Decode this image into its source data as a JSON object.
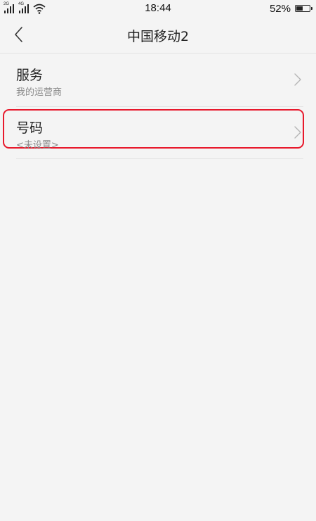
{
  "status_bar": {
    "sim1_tag": "2G",
    "sim2_tag": "4G",
    "time": "18:44",
    "battery_percent": "52%",
    "battery_level": 0.52,
    "icons": [
      "signal-icon",
      "signal-icon",
      "wifi-icon",
      "battery-icon"
    ]
  },
  "nav": {
    "title": "中国移动2",
    "back_icon": "back-chevron-icon"
  },
  "list": {
    "items": [
      {
        "title": "服务",
        "subtitle": "我的运营商"
      },
      {
        "title": "号码",
        "subtitle": "<未设置>"
      }
    ],
    "chevron_icon": "chevron-right-icon"
  },
  "colors": {
    "background": "#f4f4f4",
    "highlight": "#e8192c",
    "subtitle": "#8a8a8a"
  }
}
